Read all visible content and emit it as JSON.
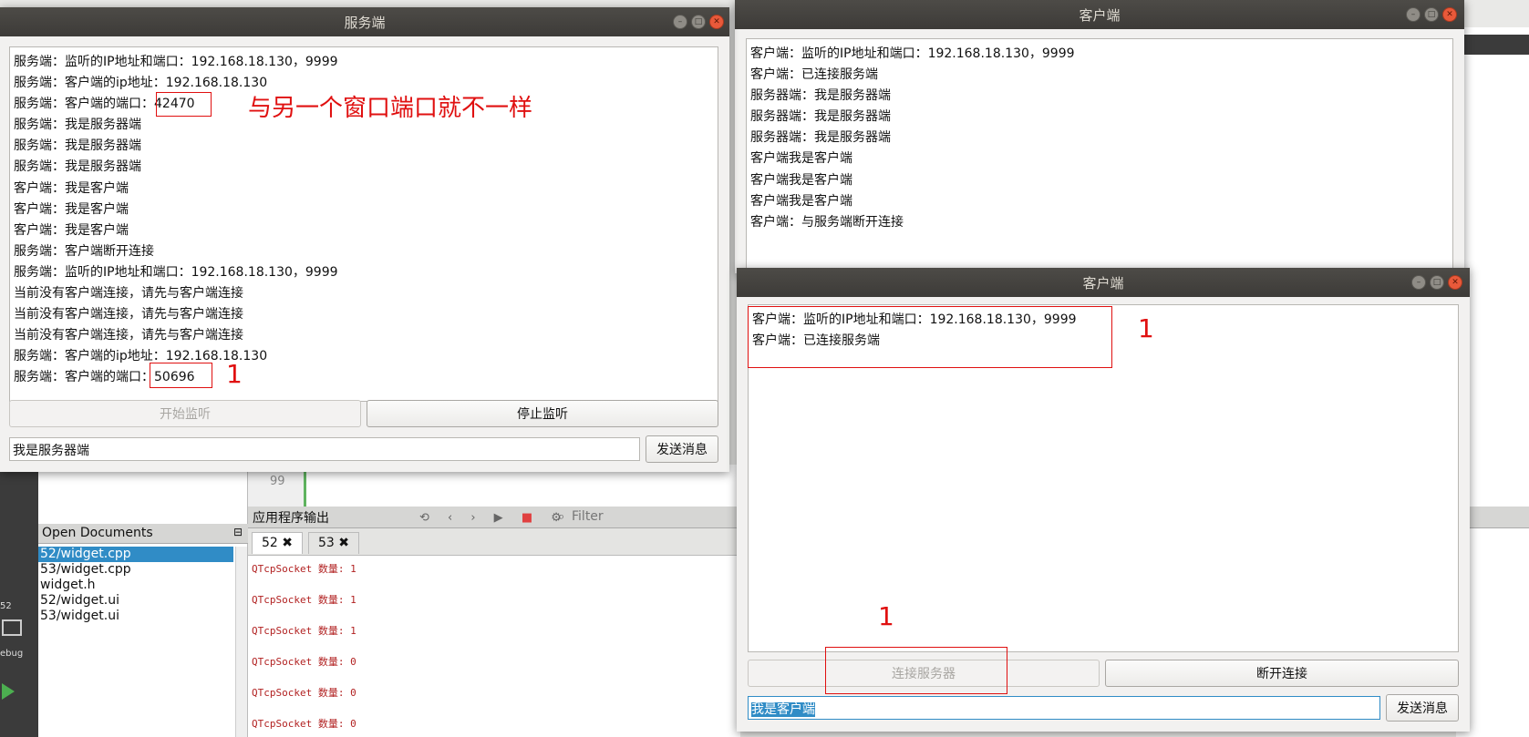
{
  "ide": {
    "open_documents_title": "Open Documents",
    "open_documents": [
      "52/widget.cpp",
      "53/widget.cpp",
      "widget.h",
      "52/widget.ui",
      "53/widget.ui"
    ],
    "output_title": "应用程序输出",
    "filter_placeholder": "Filter",
    "tabs": [
      "52 ✖",
      "53 ✖"
    ],
    "line_number": "99",
    "output_lines": [
      "QTcpSocket 数量:  1",
      "QTcpSocket 数量:  1",
      "QTcpSocket 数量:  1",
      "QTcpSocket 数量:  0",
      "QTcpSocket 数量:  0",
      "QTcpSocket 数量:  0"
    ],
    "left_label_a": "52",
    "left_label_b": "ebug"
  },
  "server": {
    "title": "服务端",
    "log": [
      "服务端：监听的IP地址和端口：192.168.18.130，9999",
      "服务端：客户端的ip地址：192.168.18.130",
      "服务端：客户端的端口：42470",
      "服务端：我是服务器端",
      "服务端：我是服务器端",
      "服务端：我是服务器端",
      "客户端：我是客户端",
      "客户端：我是客户端",
      "客户端：我是客户端",
      "服务端：客户端断开连接",
      "服务端：监听的IP地址和端口：192.168.18.130，9999",
      "当前没有客户端连接，请先与客户端连接",
      "当前没有客户端连接，请先与客户端连接",
      "当前没有客户端连接，请先与客户端连接",
      "服务端：客户端的ip地址：192.168.18.130",
      "服务端：客户端的端口：50696"
    ],
    "start_button": "开始监听",
    "stop_button": "停止监听",
    "message_value": "我是服务器端",
    "send_button": "发送消息"
  },
  "client1": {
    "title": "客户端",
    "log": [
      "客户端：监听的IP地址和端口：192.168.18.130，9999",
      "客户端：已连接服务端",
      "服务器端：我是服务器端",
      "服务器端：我是服务器端",
      "服务器端：我是服务器端",
      "客户端我是客户端",
      "客户端我是客户端",
      "客户端我是客户端",
      "客户端：与服务端断开连接"
    ]
  },
  "client2": {
    "title": "客户端",
    "log": [
      "客户端：监听的IP地址和端口：192.168.18.130，9999",
      "客户端：已连接服务端"
    ],
    "connect_button": "连接服务器",
    "disconnect_button": "断开连接",
    "message_value": "我是客户端",
    "send_button": "发送消息"
  },
  "annotations": {
    "note_port": "与另一个窗口端口就不一样",
    "mark_1": "1"
  },
  "colors": {
    "annotation": "#e01010",
    "selection": "#308cc6",
    "titlebar": "#3d3b38",
    "close": "#e8593a"
  }
}
